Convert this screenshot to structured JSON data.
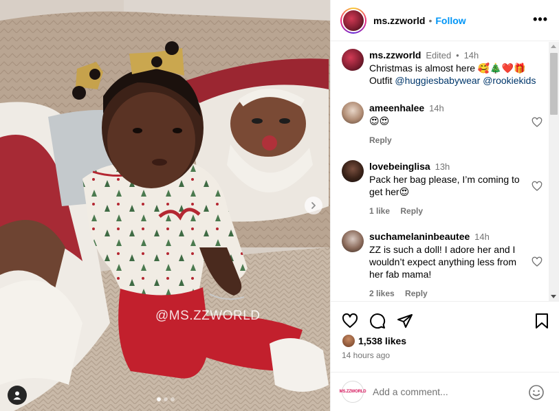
{
  "media": {
    "watermark": "@MS.ZZWORLD",
    "carousel": {
      "slides": 3,
      "current": 1
    }
  },
  "header": {
    "username": "ms.zzworld",
    "separator": "•",
    "follow_label": "Follow",
    "more_label": "•••"
  },
  "caption": {
    "username": "ms.zzworld",
    "edited": "Edited",
    "dot": "•",
    "time": "14h",
    "line1": "Christmas is almost here 🥰🎄❤️🎁",
    "outfit_prefix": "Outfit ",
    "mention1": "@huggiesbabywear",
    "mention2": "@rookiekids"
  },
  "comments": [
    {
      "username": "ameenhalee",
      "time": "14h",
      "text": "😍😍",
      "likes": "",
      "reply_label": "Reply"
    },
    {
      "username": "lovebeinglisa",
      "time": "13h",
      "text": "Pack her bag please, I’m coming to get her😍",
      "likes": "1 like",
      "reply_label": "Reply"
    },
    {
      "username": "suchamelaninbeautee",
      "time": "14h",
      "text": "ZZ is such a doll! I adore her and I wouldn’t expect anything less from her fab mama!",
      "likes": "2 likes",
      "reply_label": "Reply"
    }
  ],
  "stats": {
    "likes": "1,538 likes",
    "posted": "14 hours ago"
  },
  "add_comment": {
    "placeholder": "Add a comment...",
    "avatar_text": "MS.ZZWORLD"
  },
  "colors": {
    "accent": "#0095f6",
    "mention": "#00376b",
    "muted": "#737373"
  }
}
